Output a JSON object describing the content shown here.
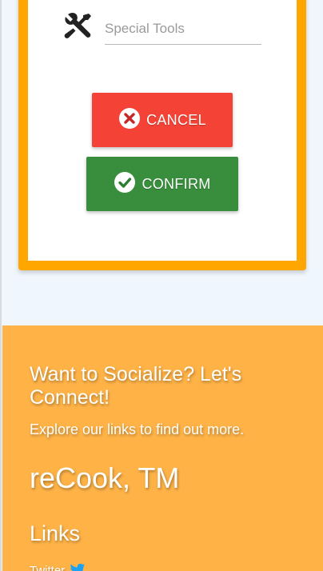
{
  "form": {
    "special_tools_placeholder": "Special Tools",
    "icons": {
      "tools": "tools-icon"
    }
  },
  "actions": {
    "cancel_label": "CANCEL",
    "confirm_label": "CONFIRM",
    "cancel_icon": "close-circle-icon",
    "confirm_icon": "check-circle-icon"
  },
  "footer": {
    "heading": "Want to Socialize? Let's Connect!",
    "subtext": "Explore our links to find out more.",
    "brand": "reCook, TM",
    "links_heading": "Links",
    "twitter_label": "Twitter",
    "twitter_icon": "twitter-bird-icon"
  },
  "colors": {
    "card_border": "#ffa600",
    "cancel": "#f44336",
    "confirm": "#388e3c",
    "footer_bg": "#ffb347",
    "page_bg": "#f0f6fd"
  }
}
